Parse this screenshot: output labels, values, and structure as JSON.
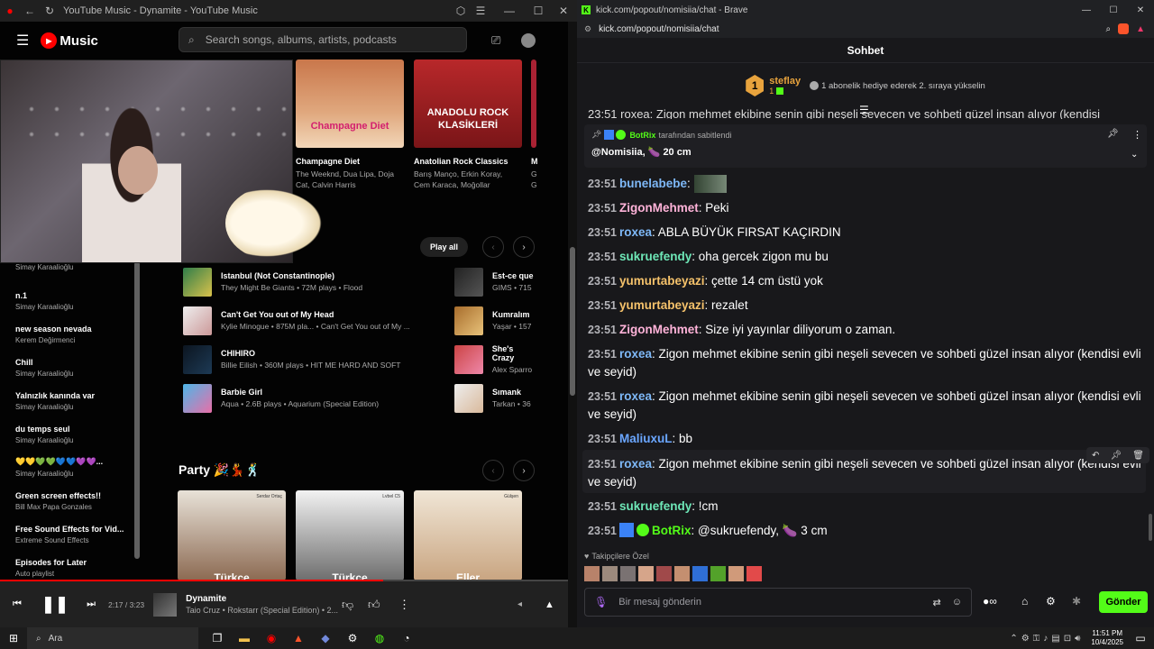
{
  "yt": {
    "window_title": "YouTube Music - Dynamite - YouTube Music",
    "logo_text": "Music",
    "search_placeholder": "Search songs, albums, artists, podcasts",
    "cards": [
      {
        "title": "Champagne Diet",
        "sub1": "The Weeknd, Dua Lipa, Doja",
        "sub2": "Cat, Calvin Harris",
        "art": "Champagne Diet"
      },
      {
        "title": "Anatolian Rock Classics",
        "sub1": "Barış Manço, Erkin Koray,",
        "sub2": "Cem Karaca, Moğollar",
        "art": "ANADOLU ROCK KLASİKLERİ"
      },
      {
        "title": "M",
        "sub1": "G",
        "sub2": "G"
      }
    ],
    "play_all": "Play all",
    "songs_left": [
      {
        "title": "Istanbul (Not Constantinople)",
        "sub": "They Might Be Giants • 72M plays • Flood"
      },
      {
        "title": "Can't Get You out of My Head",
        "sub": "Kylie Minogue • 875M pla... • Can't Get You out of My ..."
      },
      {
        "title": "CHIHIRO",
        "sub": "Billie Eilish • 360M plays • HIT ME HARD AND SOFT"
      },
      {
        "title": "Barbie Girl",
        "sub": "Aqua • 2.6B plays • Aquarium (Special Edition)"
      }
    ],
    "songs_right": [
      {
        "title": "Est-ce que",
        "sub": "GIMS • 715"
      },
      {
        "title": "Kumralım",
        "sub": "Yaşar • 157"
      },
      {
        "title": "She's Crazy",
        "sub": "Alex Sparro"
      },
      {
        "title": "Sımank",
        "sub": "Tarkan • 36"
      }
    ],
    "party_title": "Party 🎉💃🕺",
    "party_cards": [
      {
        "label": "Türkçe",
        "tag": "Serdar Ortaç"
      },
      {
        "label": "Türkçe",
        "tag": "Lvbel C5"
      },
      {
        "label": "Eller",
        "tag": "Gülşen"
      }
    ],
    "sidebar": [
      {
        "title": "",
        "sub": "Simay Karaalioğlu"
      },
      {
        "title": "n.1",
        "sub": "Simay Karaalioğlu"
      },
      {
        "title": "new season nevada",
        "sub": "Kerem Değirmenci"
      },
      {
        "title": "Chill",
        "sub": "Simay Karaalioğlu"
      },
      {
        "title": "Yalnızlık kanında var",
        "sub": "Simay Karaalioğlu"
      },
      {
        "title": "du temps seul",
        "sub": "Simay Karaalioğlu"
      },
      {
        "title": "💛💛💚💚💙💙💜💜...",
        "sub": "Simay Karaalioğlu"
      },
      {
        "title": "Green screen effects!!",
        "sub": "Bill Max Papa Gonzales"
      },
      {
        "title": "Free Sound Effects for Vid...",
        "sub": "Extreme Sound Effects"
      },
      {
        "title": "Episodes for Later",
        "sub": "Auto playlist"
      }
    ],
    "player": {
      "time": "2:17 / 3:23",
      "title": "Dynamite",
      "sub": "Taio Cruz • Rokstarr (Special Edition) • 2...",
      "progress": 0.675
    }
  },
  "kick": {
    "window_title": "kick.com/popout/nomisiia/chat - Brave",
    "url": "kick.com/popout/nomisiia/chat",
    "header": "Sohbet",
    "gifter": {
      "rank": "1",
      "name": "steflay",
      "count": "1",
      "msg": "1 abonelik hediye ederek 2. sıraya yükselin"
    },
    "cut_line": "23:51 roxea: Zigon mehmet ekibine senin gibi neşeli sevecen ve sohbeti güzel insan alıyor (kendisi",
    "pinned": {
      "by": "BotRix",
      "label": "tarafından sabitlendi",
      "text": "@Nomisiia, 🍆 20 cm"
    },
    "messages": [
      {
        "time": "23:51",
        "user": "bunelabebe",
        "color": "#7eb8f7",
        "text": ""
      },
      {
        "time": "23:51",
        "user": "ZigonMehmet",
        "color": "#ffb3d9",
        "text": "Peki"
      },
      {
        "time": "23:51",
        "user": "roxea",
        "color": "#7eb8f7",
        "text": "ABLA BÜYÜK FIRSAT KAÇIRDIN"
      },
      {
        "time": "23:51",
        "user": "sukruefendy",
        "color": "#6ee7b7",
        "text": "oha gercek zigon mu bu"
      },
      {
        "time": "23:51",
        "user": "yumurtabeyazi",
        "color": "#f5c26b",
        "text": "çette 14 cm üstü yok"
      },
      {
        "time": "23:51",
        "user": "yumurtabeyazi",
        "color": "#f5c26b",
        "text": "rezalet"
      },
      {
        "time": "23:51",
        "user": "ZigonMehmet",
        "color": "#ffb3d9",
        "text": "Size iyi yayınlar diliyorum o zaman."
      },
      {
        "time": "23:51",
        "user": "roxea",
        "color": "#7eb8f7",
        "text": "Zigon mehmet ekibine senin gibi neşeli sevecen ve sohbeti güzel insan alıyor (kendisi evli ve seyid)"
      },
      {
        "time": "23:51",
        "user": "roxea",
        "color": "#7eb8f7",
        "text": "Zigon mehmet ekibine senin gibi neşeli sevecen ve sohbeti güzel insan alıyor (kendisi evli ve seyid)"
      },
      {
        "time": "23:51",
        "user": "MaliuxuL",
        "color": "#6aa6ff",
        "text": "bb"
      },
      {
        "time": "23:51",
        "user": "roxea",
        "color": "#7eb8f7",
        "text": "Zigon mehmet ekibine senin gibi neşeli sevecen ve sohbeti güzel insan alıyor (kendisi evli ve seyid)"
      },
      {
        "time": "23:51",
        "user": "sukruefendy",
        "color": "#6ee7b7",
        "text": "!cm"
      },
      {
        "time": "23:51",
        "user": "BotRix",
        "color": "#53fc18",
        "text": "@sukruefendy, 🍆 3 cm"
      }
    ],
    "emote_label": "Takipçilere Özel",
    "input_placeholder": "Bir mesaj gönderin",
    "send_label": "Gönder"
  },
  "taskbar": {
    "search": "Ara",
    "time": "11:51 PM",
    "date": "10/4/2025"
  }
}
